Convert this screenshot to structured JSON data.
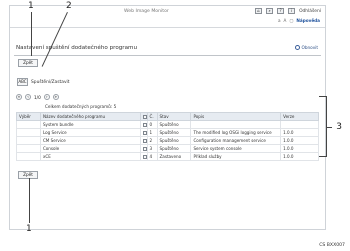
{
  "header": {
    "app_title": "Web Image Monitor",
    "logout": "Odhlášení",
    "help_label": "Nápověda"
  },
  "page": {
    "title": "Nastavení spuštění dodatečného programu",
    "refresh_label": "Obnovit",
    "back_label": "Zpět",
    "start_stop_button": "ABC",
    "start_stop_label": "Spuštění/Zastavit",
    "pager": "1/0",
    "total": "Celkem dodatečných programů: 5"
  },
  "table": {
    "headers": [
      "Výběr",
      "Název dodatečného programu",
      "",
      "Č.",
      "Stav",
      "Popis",
      "Verze"
    ],
    "rows": [
      {
        "name": "System bundle",
        "no": "0",
        "status": "Spuštěno",
        "desc": "",
        "version": ""
      },
      {
        "name": "Log Service",
        "no": "1",
        "status": "Spuštěno",
        "desc": "The modified log OSGi logging service",
        "version": "1.0.0"
      },
      {
        "name": "CM Service",
        "no": "2",
        "status": "Spuštěno",
        "desc": "Configuration management service",
        "version": "1.0.0"
      },
      {
        "name": "Console",
        "no": "3",
        "status": "Spuštěno",
        "desc": "Service system console",
        "version": "1.0.0"
      },
      {
        "name": "xCE",
        "no": "4",
        "status": "Zastaveno",
        "desc": "Příklad služby",
        "version": "1.0.0"
      }
    ]
  },
  "callouts": [
    "1",
    "2",
    "3",
    "1"
  ],
  "figure_code": "CS BXX007"
}
